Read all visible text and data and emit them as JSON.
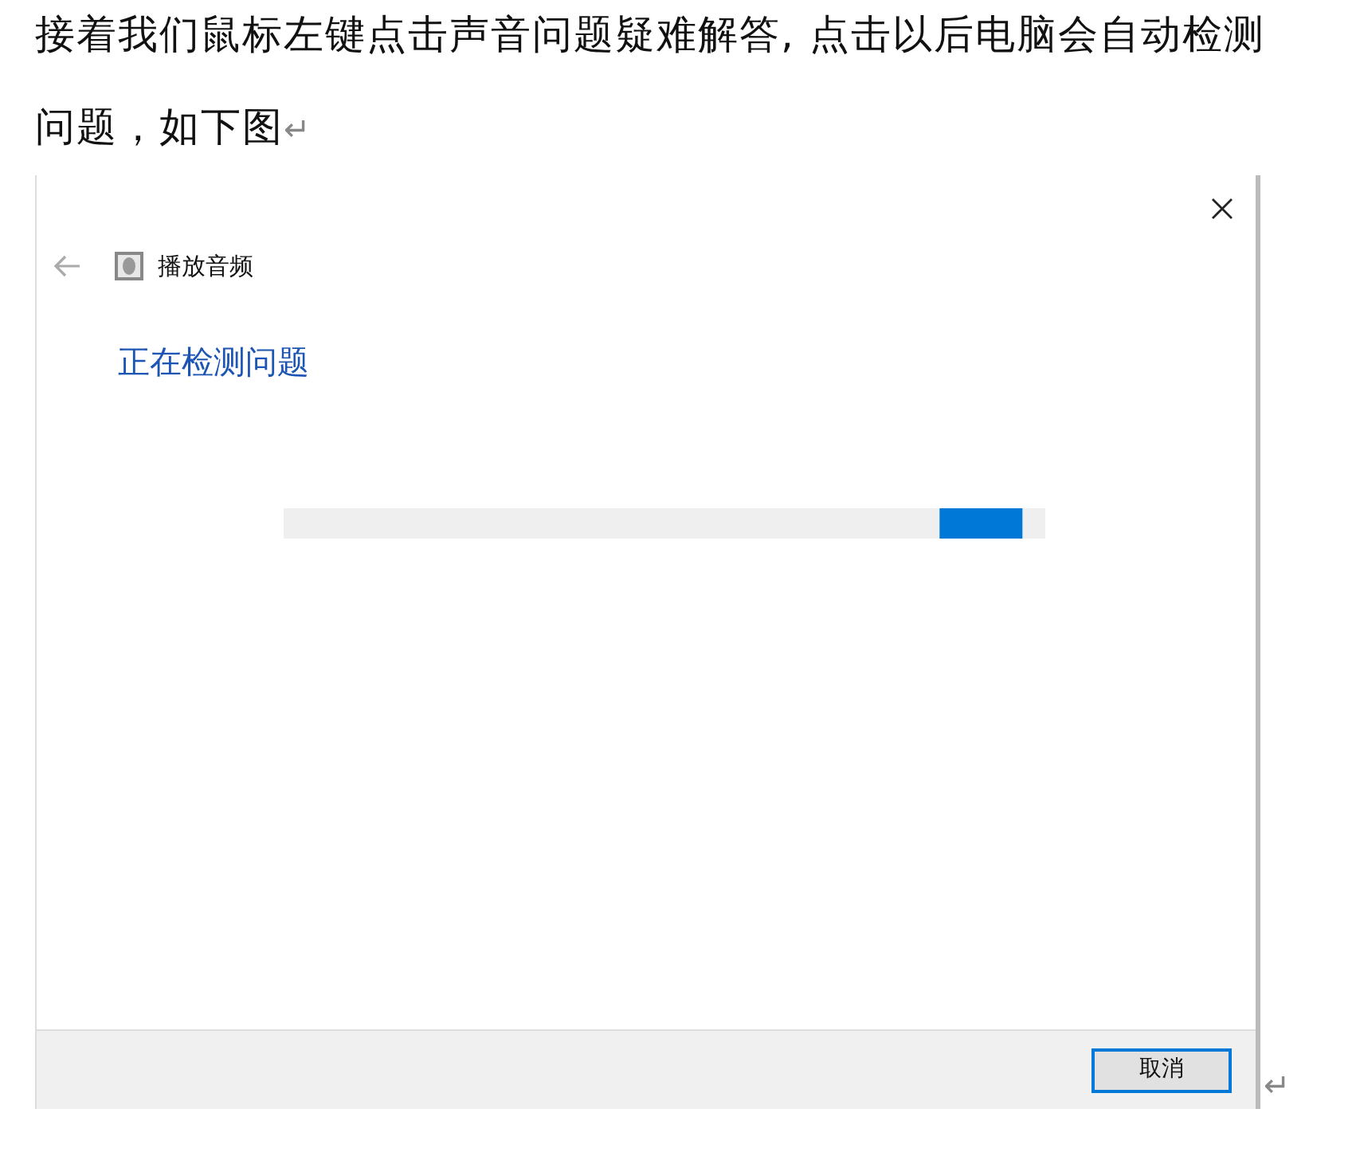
{
  "document": {
    "paragraph": "接着我们鼠标左键点击声音问题疑难解答, 点击以后电脑会自动检测问题，如下图",
    "paragraph_mark": "↵",
    "image_mark": "↵"
  },
  "dialog": {
    "title": "播放音频",
    "heading": "正在检测问题",
    "progress": {
      "level": 0.97
    },
    "buttons": [
      {
        "label": "取消",
        "selected": true
      }
    ]
  }
}
